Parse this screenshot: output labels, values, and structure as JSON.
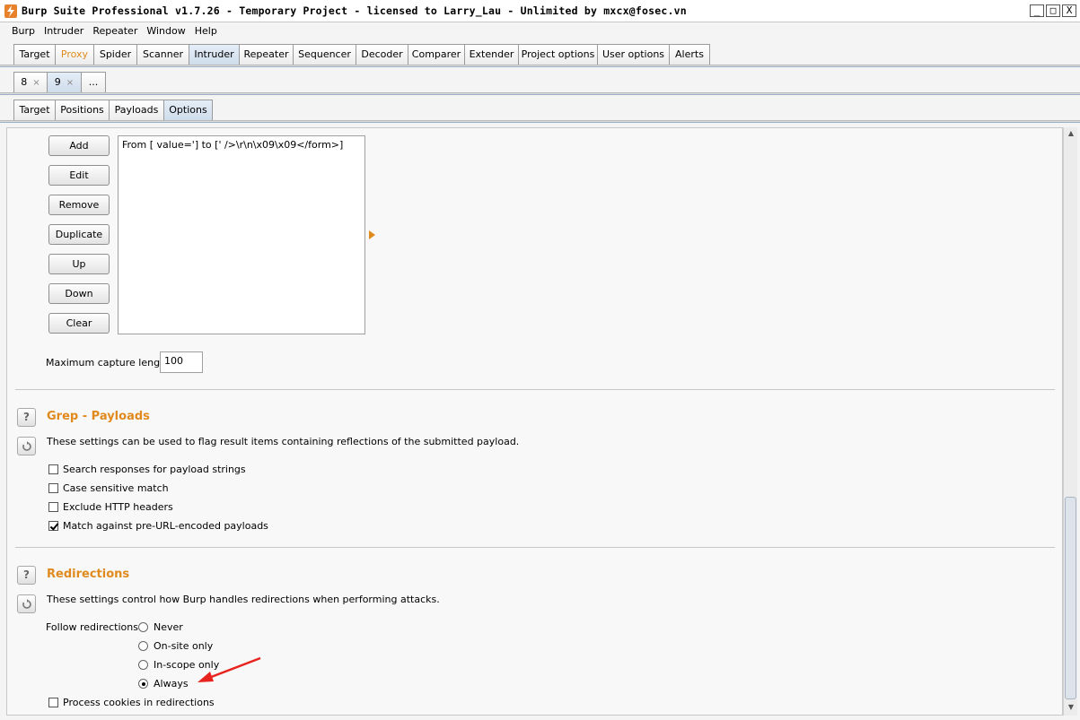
{
  "window": {
    "title": "Burp Suite Professional v1.7.26 - Temporary Project - licensed to Larry_Lau - Unlimited by mxcx@fosec.vn",
    "controls": [
      "_",
      "□",
      "X"
    ]
  },
  "menu": [
    "Burp",
    "Intruder",
    "Repeater",
    "Window",
    "Help"
  ],
  "main_tabs": [
    "Target",
    "Proxy",
    "Spider",
    "Scanner",
    "Intruder",
    "Repeater",
    "Sequencer",
    "Decoder",
    "Comparer",
    "Extender",
    "Project options",
    "User options",
    "Alerts"
  ],
  "main_tabs_selected": "Intruder",
  "attack_tabs": [
    {
      "label": "8",
      "close": "×"
    },
    {
      "label": "9",
      "close": "×"
    },
    {
      "label": "..."
    }
  ],
  "intruder_tabs": [
    "Target",
    "Positions",
    "Payloads",
    "Options"
  ],
  "intruder_tabs_selected": "Options",
  "extract": {
    "buttons": [
      "Add",
      "Edit",
      "Remove",
      "Duplicate",
      "Up",
      "Down",
      "Clear"
    ],
    "items": [
      "From [ value='] to [' />\\r\\n\\x09\\x09</form>]"
    ],
    "max_capture_label": "Maximum capture length:",
    "max_capture_value": "100"
  },
  "grep_payloads": {
    "help_icon": "?",
    "title": "Grep - Payloads",
    "description": "These settings can be used to flag result items containing reflections of the submitted payload.",
    "options": [
      {
        "label": "Search responses for payload strings",
        "checked": false
      },
      {
        "label": "Case sensitive match",
        "checked": false
      },
      {
        "label": "Exclude HTTP headers",
        "checked": false
      },
      {
        "label": "Match against pre-URL-encoded payloads",
        "checked": true
      }
    ]
  },
  "redirections": {
    "help_icon": "?",
    "title": "Redirections",
    "description": "These settings control how Burp handles redirections when performing attacks.",
    "follow_label": "Follow redirections:",
    "follow_options": [
      {
        "label": "Never",
        "selected": false
      },
      {
        "label": "On-site only",
        "selected": false
      },
      {
        "label": "In-scope only",
        "selected": false
      },
      {
        "label": "Always",
        "selected": true
      }
    ],
    "process_cookies": {
      "label": "Process cookies in redirections",
      "checked": false
    }
  },
  "colors": {
    "accent": "#e08a1e",
    "annotation": "#e8231e"
  }
}
